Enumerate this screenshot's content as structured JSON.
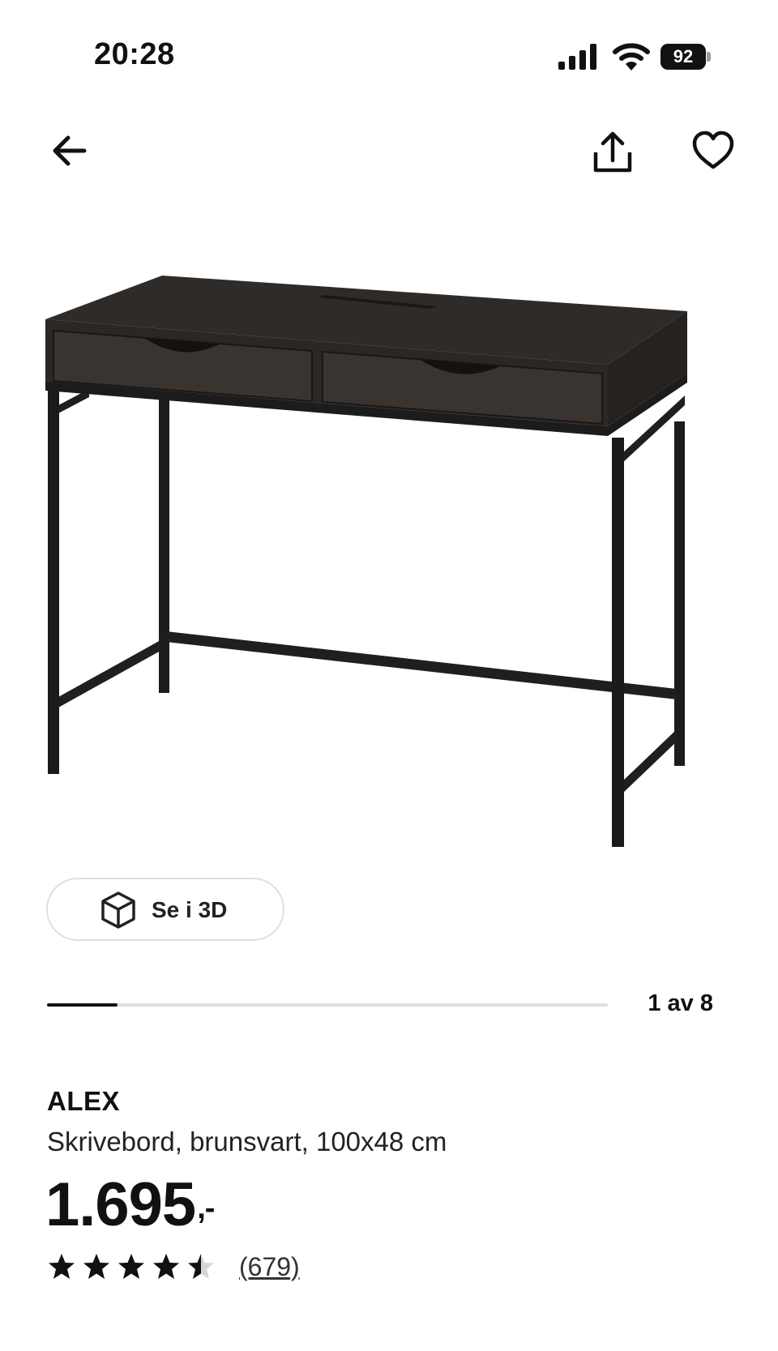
{
  "status_bar": {
    "time": "20:28",
    "battery": "92"
  },
  "nav": {
    "back_icon": "arrow-left-icon",
    "share_icon": "share-icon",
    "favorite_icon": "heart-icon"
  },
  "media": {
    "view_3d_label": "Se i 3D",
    "counter": "1 av 8",
    "progress": 0.125
  },
  "product": {
    "name": "ALEX",
    "description": "Skrivebord, brunsvart, 100x48 cm",
    "price": "1.695",
    "price_suffix": ",-",
    "rating": 4.5,
    "rating_max": 5,
    "review_count": "(679)"
  },
  "colors": {
    "text": "#111111",
    "desk_top": "#2f2b29",
    "desk_frame": "#1c1c1c",
    "border": "#dfdfdf"
  }
}
